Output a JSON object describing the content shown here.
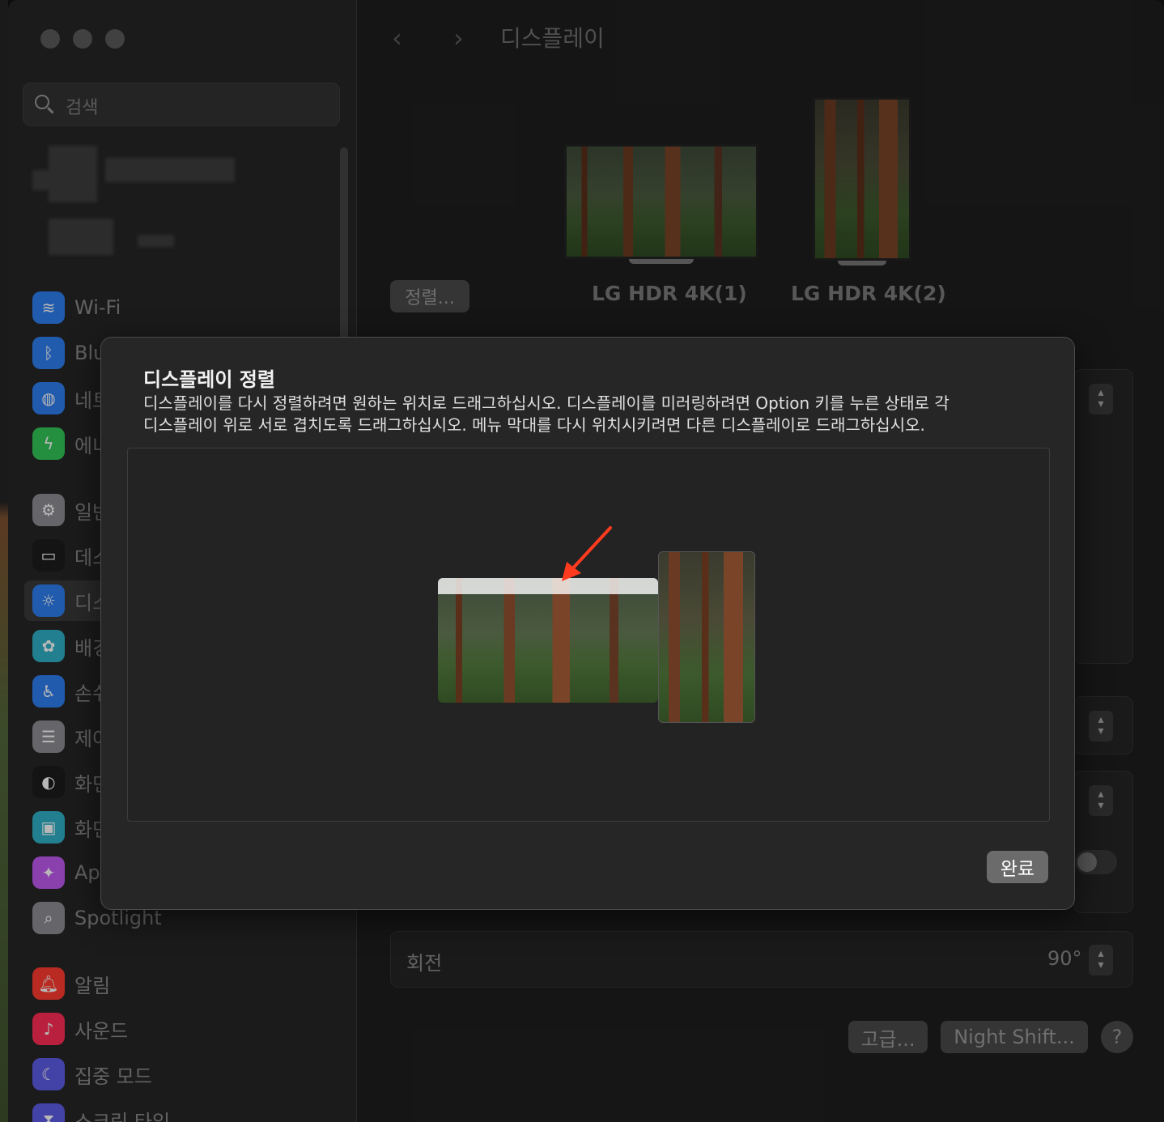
{
  "window": {
    "title": "디스플레이"
  },
  "search": {
    "placeholder": "검색"
  },
  "sidebar": {
    "items": [
      {
        "label": "Wi-Fi",
        "icon": "wifi-icon",
        "color": "#2f7ff0"
      },
      {
        "label": "Blu",
        "icon": "bluetooth-icon",
        "color": "#2f7ff0"
      },
      {
        "label": "네트",
        "icon": "globe-icon",
        "color": "#2f7ff0"
      },
      {
        "label": "에너",
        "icon": "bolt-icon",
        "color": "#34c759"
      },
      {
        "label": "일반",
        "icon": "gear-icon",
        "color": "#8e8e93"
      },
      {
        "label": "데스",
        "icon": "dock-icon",
        "color": "#1c1c1e"
      },
      {
        "label": "디스",
        "icon": "sun-icon",
        "color": "#2f7ff0"
      },
      {
        "label": "배경",
        "icon": "flower-icon",
        "color": "#30b0c7"
      },
      {
        "label": "손쉬",
        "icon": "accessibility-icon",
        "color": "#2f7ff0"
      },
      {
        "label": "제어",
        "icon": "control-center-icon",
        "color": "#8e8e93"
      },
      {
        "label": "화면",
        "icon": "appearance-icon",
        "color": "#1c1c1e"
      },
      {
        "label": "화면",
        "icon": "screensaver-icon",
        "color": "#30b0c7"
      },
      {
        "label": "Ap",
        "icon": "siri-icon",
        "color": "#bf5af2"
      },
      {
        "label": "Spotlight",
        "icon": "magnifier-icon",
        "color": "#8e8e93"
      },
      {
        "label": "알림",
        "icon": "bell-icon",
        "color": "#ff3b30"
      },
      {
        "label": "사운드",
        "icon": "speaker-icon",
        "color": "#ff2d55"
      },
      {
        "label": "집중 모드",
        "icon": "moon-icon",
        "color": "#5e5ce6"
      },
      {
        "label": "스크린 타임",
        "icon": "hourglass-icon",
        "color": "#5e5ce6"
      }
    ]
  },
  "main": {
    "arrange_button": "정렬...",
    "monitors": [
      {
        "name": "LG HDR 4K(1)"
      },
      {
        "name": "LG HDR 4K(2)"
      }
    ],
    "rotation_label": "회전",
    "rotation_value": "90°",
    "advanced_button": "고급...",
    "night_shift_button": "Night Shift...",
    "help_button": "?"
  },
  "sheet": {
    "title": "디스플레이 정렬",
    "description_line1": "디스플레이를 다시 정렬하려면 원하는 위치로 드래그하십시오. 디스플레이를 미러링하려면 Option 키를 누른 상태로 각",
    "description_line2": "디스플레이 위로 서로 겹치도록 드래그하십시오. 메뉴 막대를 다시 위치시키려면 다른 디스플레이로 드래그하십시오.",
    "done_button": "완료"
  }
}
